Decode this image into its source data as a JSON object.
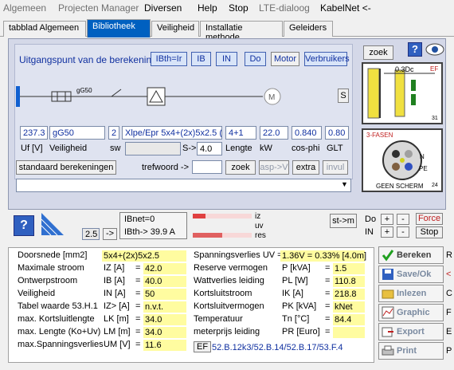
{
  "menu": [
    "Algemeen",
    "Projecten Manager",
    "Diversen",
    "Help",
    "Stop",
    "LTE-dialoog",
    "KabelNet <-"
  ],
  "tabs": [
    "tabblad Algemeen",
    "Bibliotheek",
    "Veiligheid",
    "Installatie methode",
    "Geleiders"
  ],
  "calc": {
    "start_label": "Uitgangspunt van de berekening",
    "buttons": [
      "IBth=Ir",
      "IB",
      "IN",
      "Do",
      "Motor",
      "Verbruikers"
    ],
    "zoek_top": "zoek",
    "schema_label": "gG50",
    "s_button": "S",
    "fields": {
      "uf": "237.3",
      "veiligheid": "gG50",
      "sw": "2",
      "cable": "Xlpe/Epr 5x4+(2x)5x2.5 (",
      "lengte": "4+1",
      "kw": "22.0",
      "cosphi": "0.840",
      "glt": "0.80",
      "s": "4.0"
    },
    "captions": {
      "uf": "Uf [V]",
      "veiligheid": "Veiligheid",
      "sw": "sw",
      "s": "S->",
      "lengte": "Lengte",
      "kw": "kW",
      "cosphi": "cos-phi",
      "glt": "GLT"
    },
    "standaard": "standaard berekeningen",
    "trefwoord": "trefwoord ->",
    "zoek2": "zoek",
    "asp": "asp->V",
    "extra": "extra",
    "invul": "invul"
  },
  "right_panel": {
    "zoek": "zoek",
    "img1_label": "0.3Dc",
    "img1_ef": "EF",
    "img1_num": "31",
    "img2_title": "3-FASEN",
    "img2_n": "N",
    "img2_pe": "PE",
    "img2_footer": "GEEN SCHERM",
    "img2_num": "24"
  },
  "mid": {
    "ibnet": "IBnet=0",
    "ibth": "IBth->  39.9 A",
    "val25": "2.5",
    "arrow": "->",
    "legend": [
      "iz",
      "uv",
      "res"
    ],
    "stm": "st->m",
    "do": "Do",
    "in": "IN",
    "force": "Force",
    "stop": "Stop"
  },
  "results": {
    "left": [
      {
        "label": "Doorsnede [mm2]",
        "unit": "=",
        "value": "5x4+(2x)5x2.5"
      },
      {
        "label": "Maximale stroom",
        "unit": "IZ  [A]",
        "value": "42.0"
      },
      {
        "label": "Ontwerpstroom",
        "unit": "IB  [A]",
        "value": "40.0"
      },
      {
        "label": "Veiligheid",
        "unit": "IN  [A]",
        "value": "50"
      },
      {
        "label": "Tabel waarde 53.H.1",
        "unit": "IZ>  [A]",
        "value": "n.v.t."
      },
      {
        "label": "max. Kortsluitlengte",
        "unit": "LK  [m]",
        "value": "34.0"
      },
      {
        "label": "max. Lengte (Ko+Uv)",
        "unit": "LM  [m]",
        "value": "34.0"
      },
      {
        "label": "max.Spanningsverlies",
        "unit": "UM [V]",
        "value": "11.6"
      }
    ],
    "right": [
      {
        "label": "Spanningsverlies UV =",
        "unit": "",
        "value": "1.36V = 0.33% [4.0m]"
      },
      {
        "label": "Reserve vermogen",
        "unit": "P   [kVA]",
        "value": "1.5"
      },
      {
        "label": "Wattverlies leiding",
        "unit": "PL  [W]",
        "value": "110.8"
      },
      {
        "label": "Kortsluitstroom",
        "unit": "IK   [A]",
        "value": "218.8"
      },
      {
        "label": "Kortsluitvermogen",
        "unit": "PK  [kVA]",
        "value": "kNet"
      },
      {
        "label": "Temperatuur",
        "unit": "Tn  [°C]",
        "value": "84.4"
      },
      {
        "label": "meterprijs leiding",
        "unit": "PR [Euro]",
        "value": ""
      }
    ],
    "ef_label": "EF",
    "ef_refs": "52.B.12k3/52.B.14/52.B.17/53.F.4"
  },
  "side_buttons": [
    {
      "label": "Bereken",
      "key": "R"
    },
    {
      "label": "Save/Ok",
      "key": "<"
    },
    {
      "label": "Inlezen",
      "key": "C"
    },
    {
      "label": "Graphic",
      "key": "F"
    },
    {
      "label": "Export",
      "key": "E"
    },
    {
      "label": "Print",
      "key": "P"
    }
  ]
}
